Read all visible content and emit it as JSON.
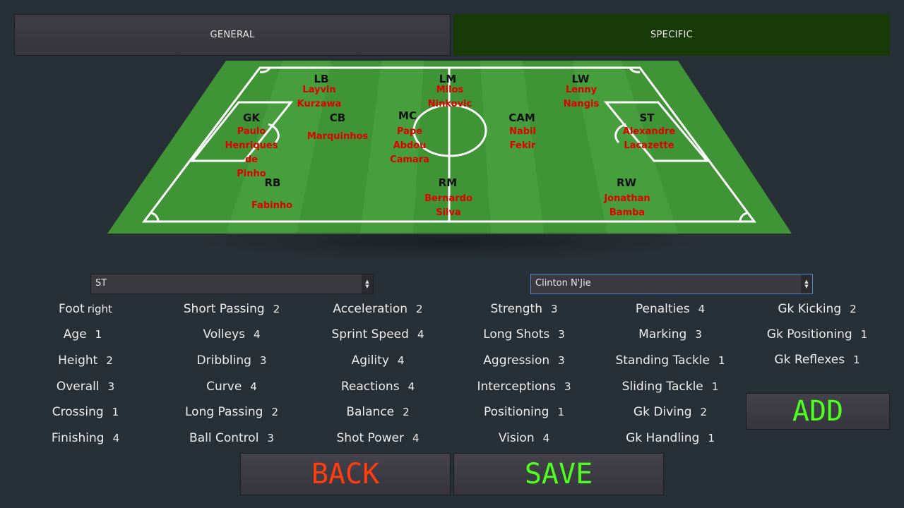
{
  "tabs": {
    "general": "GENERAL",
    "specific": "SPECIFIC"
  },
  "pitch": {
    "positions": [
      {
        "label": "LB",
        "player": [
          "Layvin",
          "Kurzawa"
        ]
      },
      {
        "label": "LM",
        "player": [
          "Milos",
          "Ninkovic"
        ]
      },
      {
        "label": "LW",
        "player": [
          "Lenny",
          "Nangis"
        ]
      },
      {
        "label": "GK",
        "player": [
          "Paulo",
          "Henriques",
          "de",
          "Pinho"
        ]
      },
      {
        "label": "CB",
        "player": [
          "Marquinhos"
        ]
      },
      {
        "label": "MC",
        "player": [
          "Pape",
          "Abdou",
          "Camara"
        ]
      },
      {
        "label": "CAM",
        "player": [
          "Nabil",
          "Fekir"
        ]
      },
      {
        "label": "ST",
        "player": [
          "Alexandre",
          "Lacazette"
        ]
      },
      {
        "label": "RB",
        "player": [
          "Fabinho"
        ]
      },
      {
        "label": "RM",
        "player": [
          "Bernardo",
          "Silva"
        ]
      },
      {
        "label": "RW",
        "player": [
          "Jonathan",
          "Bamba"
        ]
      }
    ]
  },
  "position_select": {
    "value": "ST"
  },
  "player_select": {
    "value": "Clinton N'Jie"
  },
  "stats": {
    "foot": {
      "label": "Foot",
      "value": "right"
    },
    "age": {
      "label": "Age",
      "value": "1"
    },
    "height": {
      "label": "Height",
      "value": "2"
    },
    "overall": {
      "label": "Overall",
      "value": "3"
    },
    "crossing": {
      "label": "Crossing",
      "value": "1"
    },
    "finishing": {
      "label": "Finishing",
      "value": "4"
    },
    "short_passing": {
      "label": "Short Passing",
      "value": "2"
    },
    "volleys": {
      "label": "Volleys",
      "value": "4"
    },
    "dribbling": {
      "label": "Dribbling",
      "value": "3"
    },
    "curve": {
      "label": "Curve",
      "value": "4"
    },
    "long_passing": {
      "label": "Long Passing",
      "value": "2"
    },
    "ball_control": {
      "label": "Ball Control",
      "value": "3"
    },
    "acceleration": {
      "label": "Acceleration",
      "value": "2"
    },
    "sprint_speed": {
      "label": "Sprint Speed",
      "value": "4"
    },
    "agility": {
      "label": "Agility",
      "value": "4"
    },
    "reactions": {
      "label": "Reactions",
      "value": "4"
    },
    "balance": {
      "label": "Balance",
      "value": "2"
    },
    "shot_power": {
      "label": "Shot Power",
      "value": "4"
    },
    "strength": {
      "label": "Strength",
      "value": "3"
    },
    "long_shots": {
      "label": "Long Shots",
      "value": "3"
    },
    "aggression": {
      "label": "Aggression",
      "value": "3"
    },
    "interceptions": {
      "label": "Interceptions",
      "value": "3"
    },
    "positioning": {
      "label": "Positioning",
      "value": "1"
    },
    "vision": {
      "label": "Vision",
      "value": "4"
    },
    "penalties": {
      "label": "Penalties",
      "value": "4"
    },
    "marking": {
      "label": "Marking",
      "value": "3"
    },
    "standing_tackle": {
      "label": "Standing Tackle",
      "value": "1"
    },
    "sliding_tackle": {
      "label": "Sliding Tackle",
      "value": "1"
    },
    "gk_diving": {
      "label": "Gk Diving",
      "value": "2"
    },
    "gk_handling": {
      "label": "Gk Handling",
      "value": "1"
    },
    "gk_kicking": {
      "label": "Gk Kicking",
      "value": "2"
    },
    "gk_positioning": {
      "label": "Gk Positioning",
      "value": "1"
    },
    "gk_reflexes": {
      "label": "Gk Reflexes",
      "value": "1"
    }
  },
  "buttons": {
    "add": "ADD",
    "back": "BACK",
    "save": "SAVE"
  },
  "colors": {
    "background": "#283037",
    "pitch_green": "#3f9436",
    "player_name": "#e00000",
    "positive": "#4dff1f",
    "negative": "#ff3d0e",
    "specific_tab": "#173a08"
  }
}
